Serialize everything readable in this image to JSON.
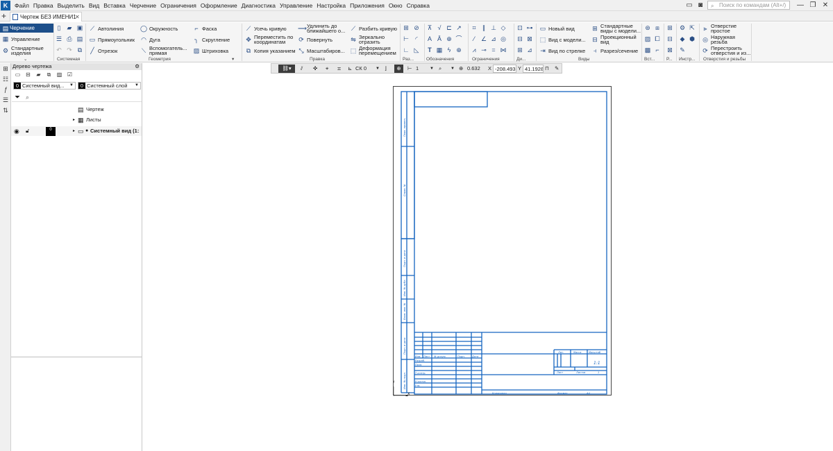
{
  "app": {
    "logo_text": "K"
  },
  "menu": {
    "items": [
      "Файл",
      "Правка",
      "Выделить",
      "Вид",
      "Вставка",
      "Черчение",
      "Ограничения",
      "Оформление",
      "Диагностика",
      "Управление",
      "Настройка",
      "Приложения",
      "Окно",
      "Справка"
    ]
  },
  "search": {
    "placeholder": "Поиск по командам (Alt+/)"
  },
  "tabs": {
    "document": "Чертеж БЕЗ ИМЕНИ1"
  },
  "ribbon": {
    "left": {
      "active": "Черчение",
      "manage": "Управление",
      "standard": "Стандартные изделия"
    },
    "system": {
      "label": "Системная"
    },
    "geometry": {
      "autoline": "Автолиния",
      "rectangle": "Прямоугольник",
      "segment": "Отрезок",
      "circle": "Окружность",
      "arc": "Дуга",
      "aux": "Вспомогатель... прямая",
      "chamfer": "Фаска",
      "fillet": "Скругление",
      "hatch": "Штриховка",
      "label": "Геометрия"
    },
    "edit": {
      "trim": "Усечь кривую",
      "extend": "Удлинить до ближайшего о...",
      "split": "Разбить кривую",
      "move": "Переместить по координатам",
      "rotate": "Повернуть",
      "mirror": "Зеркально отразить",
      "copy": "Копия указанием",
      "scale": "Масштабиров...",
      "deform": "Деформация перемещением",
      "label": "Правка"
    },
    "groups": {
      "dims": "Раз...",
      "marks": "Обозначения",
      "constraints": "Ограничения",
      "diag": "Ди...",
      "views": "Виды",
      "insert": "Вст...",
      "r": "Р...",
      "tools": "Инстр...",
      "holes": "Отверстия и резьбы"
    },
    "views": {
      "new_view": "Новый вид",
      "view_from_model": "Вид с модели...",
      "arrow_view": "Вид по стрелке",
      "std_views": "Стандартные виды с модели...",
      "proj_view": "Проекционный вид",
      "section": "Разрез/сечение"
    },
    "holes": {
      "simple": "Отверстие простое",
      "thread": "Наружная резьба",
      "rebuild": "Перестроить отверстия и из..."
    }
  },
  "tree": {
    "title": "Дерево чертежа",
    "view_select": {
      "num": "0",
      "label": "Системный вид..."
    },
    "layer_select": {
      "num": "0",
      "label": "Системный слой"
    },
    "rows": {
      "drawing": "Чертеж",
      "sheets": "Листы",
      "sysview": "Системный вид (1:"
    },
    "sysview_num": "0"
  },
  "viewbar": {
    "style": "1",
    "cs": "СК 0",
    "zoom": "0.632",
    "x_label": "X",
    "x_val": "-208.493",
    "y_label": "Y",
    "y_val": "41.1928"
  },
  "stamp": {
    "col_headers": [
      "Изм.",
      "Лист",
      "№ докум.",
      "Подп.",
      "Дата"
    ],
    "rows": [
      "Разраб.",
      "Пров.",
      "Т.контр.",
      "Н.контр.",
      "Утв."
    ],
    "lit": "Лит.",
    "mass": "Масса",
    "scale": "Масштаб",
    "scale_value": "1:1",
    "sheet": "Лист",
    "sheets": "Листов",
    "sheets_value": "1",
    "copied": "Копировал",
    "format": "Формат",
    "format_value": "A4",
    "side": [
      "Перв. примен.",
      "Справ. №",
      "Подп. и дата",
      "Инв. № дубл.",
      "Взам. инв. №",
      "Подп. и дата",
      "Инв. № подл."
    ]
  },
  "colors": {
    "accent": "#1d4f8a",
    "frame": "#1565c0"
  }
}
